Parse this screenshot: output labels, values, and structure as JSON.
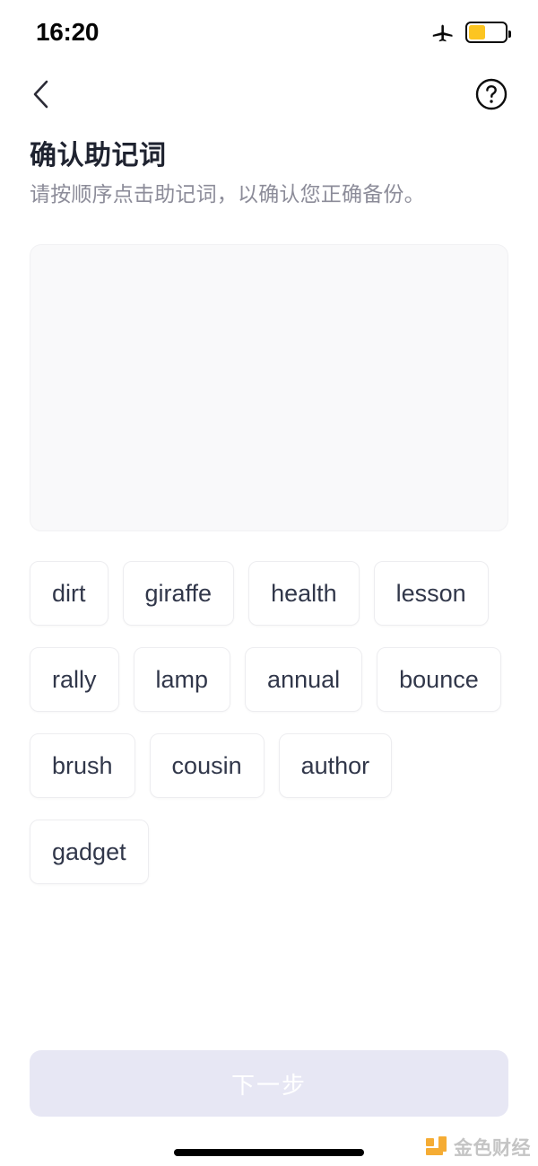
{
  "status_bar": {
    "time": "16:20",
    "airplane_icon": "airplane-mode-icon",
    "battery_icon": "battery-icon",
    "battery_level_percent": 45,
    "battery_fill_color": "#FCC521"
  },
  "nav_bar": {
    "back_icon": "chevron-left-icon",
    "help_icon": "question-mark-circle-icon"
  },
  "header": {
    "title": "确认助记词",
    "subtitle": "请按顺序点击助记词，以确认您正确备份。"
  },
  "answer_box": {
    "selected_words": [],
    "background_color": "#F9F9FA"
  },
  "word_bank": {
    "words": [
      "dirt",
      "giraffe",
      "health",
      "lesson",
      "rally",
      "lamp",
      "annual",
      "bounce",
      "brush",
      "cousin",
      "author",
      "gadget"
    ]
  },
  "footer": {
    "next_label": "下一步",
    "next_enabled": false,
    "next_disabled_color": "#E7E7F4"
  },
  "watermark": {
    "text": "金色财经",
    "logo_color": "#F5A623"
  }
}
